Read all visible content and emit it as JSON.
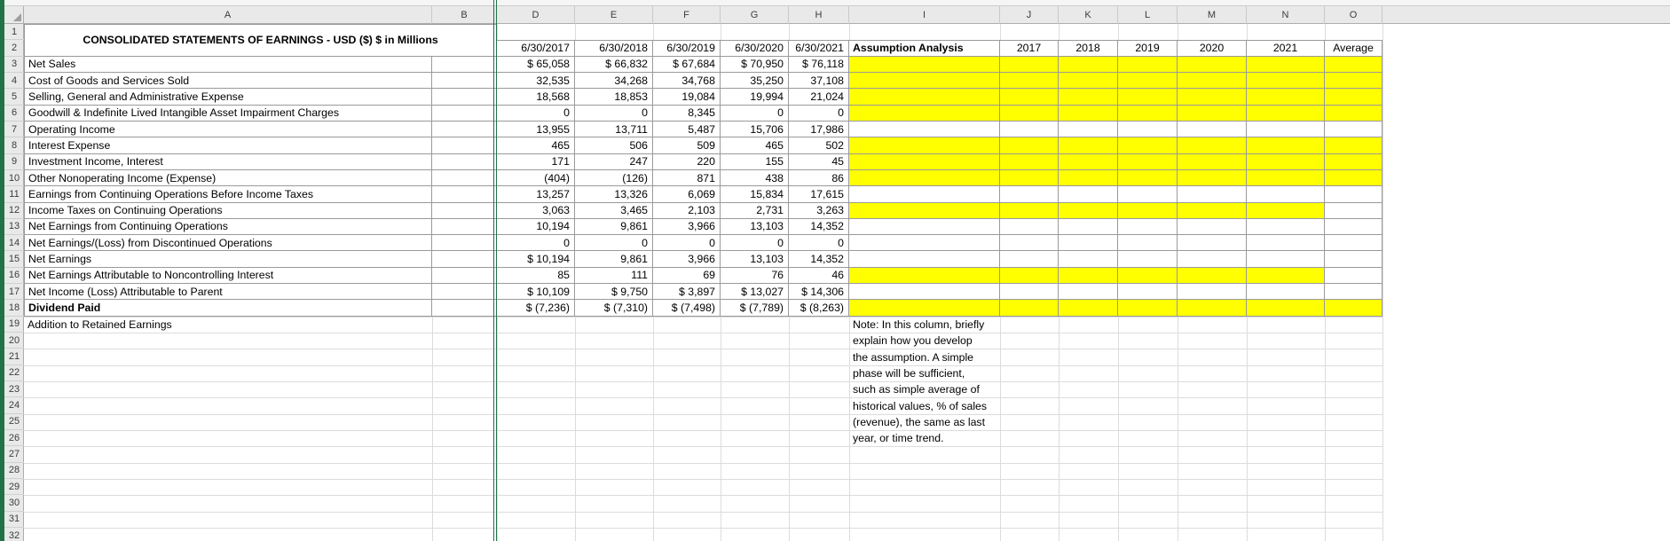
{
  "colors": {
    "highlight": "#ffff00",
    "freeze_line": "#217346",
    "grid_line": "#dcdcdc",
    "table_border": "#9a9a9a",
    "header_bg": "#e9e9e9"
  },
  "grid": {
    "column_letters": [
      "A",
      "B",
      "D",
      "E",
      "F",
      "G",
      "H",
      "I",
      "J",
      "K",
      "L",
      "M",
      "N",
      "O"
    ],
    "visible_rows": 32
  },
  "statement": {
    "title": "CONSOLIDATED STATEMENTS OF EARNINGS - USD ($) $ in Millions",
    "period_headers": [
      "6/30/2017",
      "6/30/2018",
      "6/30/2019",
      "6/30/2020",
      "6/30/2021"
    ],
    "rows": [
      {
        "row": 3,
        "label": "Net Sales",
        "bold": false,
        "values": [
          "$ 65,058",
          "$ 66,832",
          "$ 67,684",
          "$ 70,950",
          "$ 76,118"
        ],
        "highlight": "full",
        "in_table": true
      },
      {
        "row": 4,
        "label": "Cost of Goods and Services Sold",
        "bold": false,
        "values": [
          "32,535",
          "34,268",
          "34,768",
          "35,250",
          "37,108"
        ],
        "highlight": "full",
        "in_table": true
      },
      {
        "row": 5,
        "label": "Selling, General and Administrative Expense",
        "bold": false,
        "values": [
          "18,568",
          "18,853",
          "19,084",
          "19,994",
          "21,024"
        ],
        "highlight": "full",
        "in_table": true
      },
      {
        "row": 6,
        "label": "Goodwill & Indefinite Lived Intangible Asset Impairment Charges",
        "bold": false,
        "values": [
          "0",
          "0",
          "8,345",
          "0",
          "0"
        ],
        "highlight": "full",
        "in_table": true
      },
      {
        "row": 7,
        "label": "Operating Income",
        "bold": false,
        "values": [
          "13,955",
          "13,711",
          "5,487",
          "15,706",
          "17,986"
        ],
        "highlight": "none",
        "in_table": true
      },
      {
        "row": 8,
        "label": "Interest Expense",
        "bold": false,
        "values": [
          "465",
          "506",
          "509",
          "465",
          "502"
        ],
        "highlight": "full",
        "in_table": true
      },
      {
        "row": 9,
        "label": "Investment Income, Interest",
        "bold": false,
        "values": [
          "171",
          "247",
          "220",
          "155",
          "45"
        ],
        "highlight": "full",
        "in_table": true
      },
      {
        "row": 10,
        "label": "Other Nonoperating Income (Expense)",
        "bold": false,
        "values": [
          "(404)",
          "(126)",
          "871",
          "438",
          "86"
        ],
        "highlight": "full",
        "in_table": true
      },
      {
        "row": 11,
        "label": "Earnings from Continuing Operations Before Income Taxes",
        "bold": false,
        "values": [
          "13,257",
          "13,326",
          "6,069",
          "15,834",
          "17,615"
        ],
        "highlight": "none",
        "in_table": true
      },
      {
        "row": 12,
        "label": "Income Taxes on Continuing Operations",
        "bold": false,
        "values": [
          "3,063",
          "3,465",
          "2,103",
          "2,731",
          "3,263"
        ],
        "highlight": "partial",
        "in_table": true
      },
      {
        "row": 13,
        "label": "Net Earnings from Continuing Operations",
        "bold": false,
        "values": [
          "10,194",
          "9,861",
          "3,966",
          "13,103",
          "14,352"
        ],
        "highlight": "none",
        "in_table": true
      },
      {
        "row": 14,
        "label": "Net Earnings/(Loss) from Discontinued Operations",
        "bold": false,
        "values": [
          "0",
          "0",
          "0",
          "0",
          "0"
        ],
        "highlight": "none",
        "in_table": true
      },
      {
        "row": 15,
        "label": "Net Earnings",
        "bold": false,
        "values": [
          "$ 10,194",
          "9,861",
          "3,966",
          "13,103",
          "14,352"
        ],
        "highlight": "none",
        "in_table": true
      },
      {
        "row": 16,
        "label": "Net Earnings Attributable to Noncontrolling Interest",
        "bold": false,
        "values": [
          "85",
          "111",
          "69",
          "76",
          "46"
        ],
        "highlight": "partial",
        "in_table": true
      },
      {
        "row": 17,
        "label": "Net Income (Loss) Attributable to Parent",
        "bold": false,
        "values": [
          "$ 10,109",
          "$ 9,750",
          "$ 3,897",
          "$ 13,027",
          "$ 14,306"
        ],
        "highlight": "none",
        "in_table": true
      },
      {
        "row": 18,
        "label": "Dividend Paid",
        "bold": true,
        "values": [
          "$ (7,236)",
          "$ (7,310)",
          "$ (7,498)",
          "$ (7,789)",
          "$ (8,263)"
        ],
        "highlight": "full",
        "in_table": true
      },
      {
        "row": 19,
        "label": "Addition to Retained Earnings",
        "bold": false,
        "values": [
          "",
          "",
          "",
          "",
          ""
        ],
        "highlight": "none",
        "in_table": false
      }
    ]
  },
  "assumption": {
    "header": "Assumption Analysis",
    "year_headers": [
      "2017",
      "2018",
      "2019",
      "2020",
      "2021",
      "Average"
    ],
    "note_lines": [
      "Note: In this column, briefly",
      "explain how you develop",
      "the assumption. A simple",
      "phase will be sufficient,",
      "such as simple average of",
      "historical values, % of sales",
      "(revenue), the same as last",
      "year, or time trend."
    ]
  }
}
